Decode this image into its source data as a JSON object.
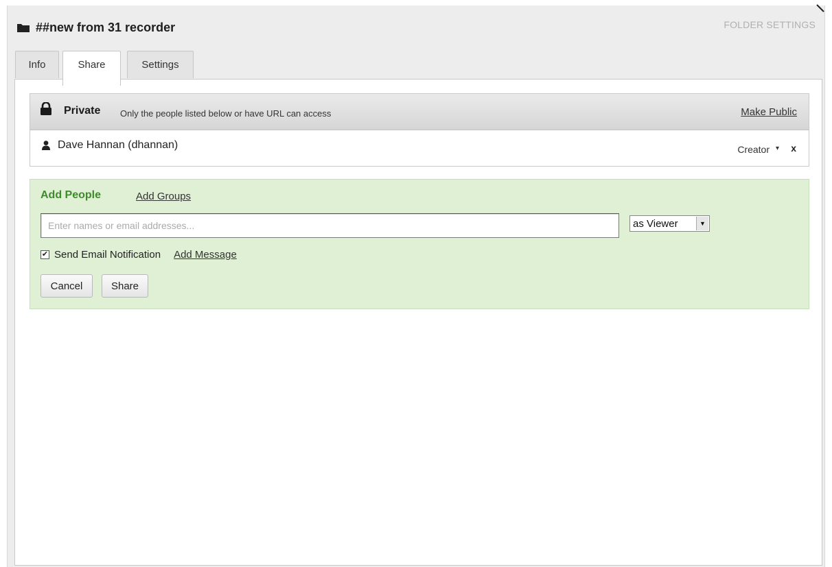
{
  "dialog": {
    "title": "##new from 31 recorder",
    "folder_settings": "FOLDER SETTINGS"
  },
  "tabs": [
    {
      "label": "Info",
      "active": false
    },
    {
      "label": "Share",
      "active": true
    },
    {
      "label": "Settings",
      "active": false
    }
  ],
  "privacy": {
    "status": "Private",
    "description": "Only the people listed below or have URL can access",
    "make_public": "Make Public"
  },
  "members": [
    {
      "name": "Dave Hannan (dhannan)",
      "role": "Creator",
      "role_caret": "▾",
      "remove": "x"
    }
  ],
  "add_people": {
    "heading": "Add People",
    "add_groups": "Add Groups",
    "input_placeholder": "Enter names or email addresses...",
    "input_value": "",
    "permission": "as Viewer",
    "send_email_checked": true,
    "send_email_label": "Send Email Notification",
    "add_message": "Add Message",
    "cancel": "Cancel",
    "share": "Share"
  },
  "colors": {
    "add_box_bg": "#dff0d5",
    "add_people_heading": "#3f8a2c",
    "folder_settings_text": "#b0b0b0"
  }
}
